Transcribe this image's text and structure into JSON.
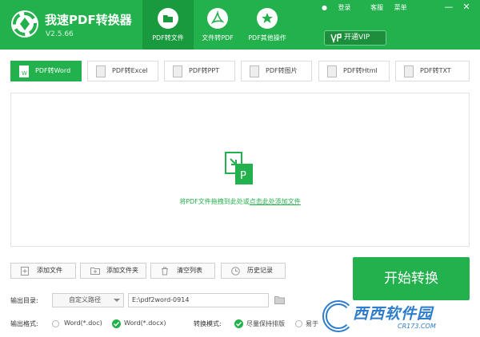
{
  "app": {
    "title": "我速PDF转换器",
    "version": "V2.5.66"
  },
  "nav": {
    "tabs": [
      {
        "label": "PDF转文件",
        "icon": "folder-icon",
        "active": true
      },
      {
        "label": "文件转PDF",
        "icon": "pdf-icon",
        "active": false
      },
      {
        "label": "PDF其他操作",
        "icon": "star-icon",
        "active": false
      }
    ]
  },
  "top_links": {
    "login": "登录",
    "service": "客服",
    "menu": "菜单"
  },
  "window_controls": {
    "minimize": "—",
    "close": "✕"
  },
  "vip_button": "开通VIP",
  "format_tabs": [
    {
      "label": "PDF转Word",
      "active": true
    },
    {
      "label": "PDF转Excel",
      "active": false
    },
    {
      "label": "PDF转PPT",
      "active": false
    },
    {
      "label": "PDF转图片",
      "active": false
    },
    {
      "label": "PDF转Html",
      "active": false
    },
    {
      "label": "PDF转TXT",
      "active": false
    }
  ],
  "drop_area": {
    "text_prefix": "将PDF文件拖拽到此处或",
    "text_link": "点击此处添加文件"
  },
  "actions": {
    "add_file": "添加文件",
    "add_folder": "添加文件夹",
    "clear_list": "清空列表",
    "history": "历史记录"
  },
  "start_button": "开始转换",
  "output": {
    "dir_label": "输出目录:",
    "path_mode": "自定义路径",
    "path_value": "E:\\pdf2word-0914",
    "format_label": "输出格式:",
    "format_options": [
      {
        "label": "Word(*.doc)",
        "selected": false
      },
      {
        "label": "Word(*.docx)",
        "selected": true
      }
    ],
    "mode_label": "转换模式:",
    "mode_options": [
      {
        "label": "尽量保持排版",
        "selected": true
      },
      {
        "label": "易于",
        "selected": false
      }
    ]
  },
  "watermark": {
    "main": "西西软件园",
    "sub": "CR173.COM"
  },
  "colors": {
    "brand_green": "#22b14c",
    "dark_green": "#1a9a3f",
    "watermark_blue": "#2d7dcc"
  }
}
